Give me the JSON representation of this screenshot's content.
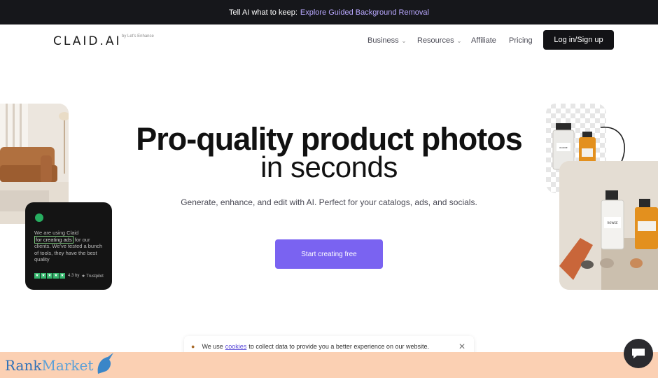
{
  "banner": {
    "prefix": "Tell AI what to keep:",
    "link": "Explore Guided Background Removal"
  },
  "nav": {
    "logo": "CLAID.AI",
    "logo_sub": "by Let's Enhance",
    "items": [
      {
        "label": "Business",
        "has_dropdown": true
      },
      {
        "label": "Resources",
        "has_dropdown": true
      },
      {
        "label": "Affiliate",
        "has_dropdown": false
      },
      {
        "label": "Pricing",
        "has_dropdown": false
      }
    ],
    "login": "Log in/Sign up"
  },
  "hero": {
    "line1": "Pro-quality product photos",
    "line2": "in seconds",
    "subtitle": "Generate, enhance, and edit with AI. Perfect for your catalogs, ads, and socials.",
    "cta": "Start creating free"
  },
  "review": {
    "text_before": "We are using Claid",
    "highlight": "for creating ads",
    "text_after": "for our clients. We've tested a bunch of tools, they have the best quality",
    "rating": "4.3 by",
    "source": "Trustpilot",
    "stars": 5
  },
  "products": {
    "brand": "ROWSE"
  },
  "cookie": {
    "before": "We use",
    "link": "cookies",
    "after": "to collect data to provide you a better experience on our website."
  },
  "watermark": {
    "part1": "Rank",
    "part2": "Market"
  },
  "colors": {
    "accent": "#7a63f1",
    "banner_link": "#b9a8ff",
    "trustpilot": "#34b36b"
  },
  "icons": [
    "chevron-down-icon",
    "user-icon",
    "star-icon",
    "close-icon",
    "chat-icon",
    "cookie-icon",
    "arrow-icon"
  ]
}
